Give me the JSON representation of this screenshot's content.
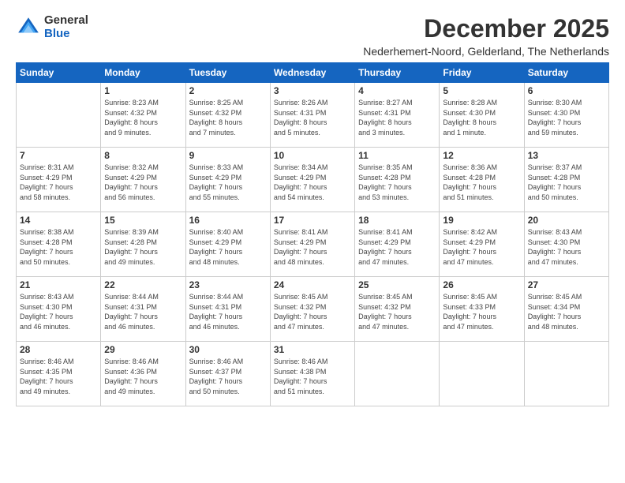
{
  "logo": {
    "general": "General",
    "blue": "Blue"
  },
  "title": "December 2025",
  "location": "Nederhemert-Noord, Gelderland, The Netherlands",
  "weekdays": [
    "Sunday",
    "Monday",
    "Tuesday",
    "Wednesday",
    "Thursday",
    "Friday",
    "Saturday"
  ],
  "weeks": [
    [
      {
        "day": "",
        "info": ""
      },
      {
        "day": "1",
        "info": "Sunrise: 8:23 AM\nSunset: 4:32 PM\nDaylight: 8 hours\nand 9 minutes."
      },
      {
        "day": "2",
        "info": "Sunrise: 8:25 AM\nSunset: 4:32 PM\nDaylight: 8 hours\nand 7 minutes."
      },
      {
        "day": "3",
        "info": "Sunrise: 8:26 AM\nSunset: 4:31 PM\nDaylight: 8 hours\nand 5 minutes."
      },
      {
        "day": "4",
        "info": "Sunrise: 8:27 AM\nSunset: 4:31 PM\nDaylight: 8 hours\nand 3 minutes."
      },
      {
        "day": "5",
        "info": "Sunrise: 8:28 AM\nSunset: 4:30 PM\nDaylight: 8 hours\nand 1 minute."
      },
      {
        "day": "6",
        "info": "Sunrise: 8:30 AM\nSunset: 4:30 PM\nDaylight: 7 hours\nand 59 minutes."
      }
    ],
    [
      {
        "day": "7",
        "info": "Sunrise: 8:31 AM\nSunset: 4:29 PM\nDaylight: 7 hours\nand 58 minutes."
      },
      {
        "day": "8",
        "info": "Sunrise: 8:32 AM\nSunset: 4:29 PM\nDaylight: 7 hours\nand 56 minutes."
      },
      {
        "day": "9",
        "info": "Sunrise: 8:33 AM\nSunset: 4:29 PM\nDaylight: 7 hours\nand 55 minutes."
      },
      {
        "day": "10",
        "info": "Sunrise: 8:34 AM\nSunset: 4:29 PM\nDaylight: 7 hours\nand 54 minutes."
      },
      {
        "day": "11",
        "info": "Sunrise: 8:35 AM\nSunset: 4:28 PM\nDaylight: 7 hours\nand 53 minutes."
      },
      {
        "day": "12",
        "info": "Sunrise: 8:36 AM\nSunset: 4:28 PM\nDaylight: 7 hours\nand 51 minutes."
      },
      {
        "day": "13",
        "info": "Sunrise: 8:37 AM\nSunset: 4:28 PM\nDaylight: 7 hours\nand 50 minutes."
      }
    ],
    [
      {
        "day": "14",
        "info": "Sunrise: 8:38 AM\nSunset: 4:28 PM\nDaylight: 7 hours\nand 50 minutes."
      },
      {
        "day": "15",
        "info": "Sunrise: 8:39 AM\nSunset: 4:28 PM\nDaylight: 7 hours\nand 49 minutes."
      },
      {
        "day": "16",
        "info": "Sunrise: 8:40 AM\nSunset: 4:29 PM\nDaylight: 7 hours\nand 48 minutes."
      },
      {
        "day": "17",
        "info": "Sunrise: 8:41 AM\nSunset: 4:29 PM\nDaylight: 7 hours\nand 48 minutes."
      },
      {
        "day": "18",
        "info": "Sunrise: 8:41 AM\nSunset: 4:29 PM\nDaylight: 7 hours\nand 47 minutes."
      },
      {
        "day": "19",
        "info": "Sunrise: 8:42 AM\nSunset: 4:29 PM\nDaylight: 7 hours\nand 47 minutes."
      },
      {
        "day": "20",
        "info": "Sunrise: 8:43 AM\nSunset: 4:30 PM\nDaylight: 7 hours\nand 47 minutes."
      }
    ],
    [
      {
        "day": "21",
        "info": "Sunrise: 8:43 AM\nSunset: 4:30 PM\nDaylight: 7 hours\nand 46 minutes."
      },
      {
        "day": "22",
        "info": "Sunrise: 8:44 AM\nSunset: 4:31 PM\nDaylight: 7 hours\nand 46 minutes."
      },
      {
        "day": "23",
        "info": "Sunrise: 8:44 AM\nSunset: 4:31 PM\nDaylight: 7 hours\nand 46 minutes."
      },
      {
        "day": "24",
        "info": "Sunrise: 8:45 AM\nSunset: 4:32 PM\nDaylight: 7 hours\nand 47 minutes."
      },
      {
        "day": "25",
        "info": "Sunrise: 8:45 AM\nSunset: 4:32 PM\nDaylight: 7 hours\nand 47 minutes."
      },
      {
        "day": "26",
        "info": "Sunrise: 8:45 AM\nSunset: 4:33 PM\nDaylight: 7 hours\nand 47 minutes."
      },
      {
        "day": "27",
        "info": "Sunrise: 8:45 AM\nSunset: 4:34 PM\nDaylight: 7 hours\nand 48 minutes."
      }
    ],
    [
      {
        "day": "28",
        "info": "Sunrise: 8:46 AM\nSunset: 4:35 PM\nDaylight: 7 hours\nand 49 minutes."
      },
      {
        "day": "29",
        "info": "Sunrise: 8:46 AM\nSunset: 4:36 PM\nDaylight: 7 hours\nand 49 minutes."
      },
      {
        "day": "30",
        "info": "Sunrise: 8:46 AM\nSunset: 4:37 PM\nDaylight: 7 hours\nand 50 minutes."
      },
      {
        "day": "31",
        "info": "Sunrise: 8:46 AM\nSunset: 4:38 PM\nDaylight: 7 hours\nand 51 minutes."
      },
      {
        "day": "",
        "info": ""
      },
      {
        "day": "",
        "info": ""
      },
      {
        "day": "",
        "info": ""
      }
    ]
  ]
}
